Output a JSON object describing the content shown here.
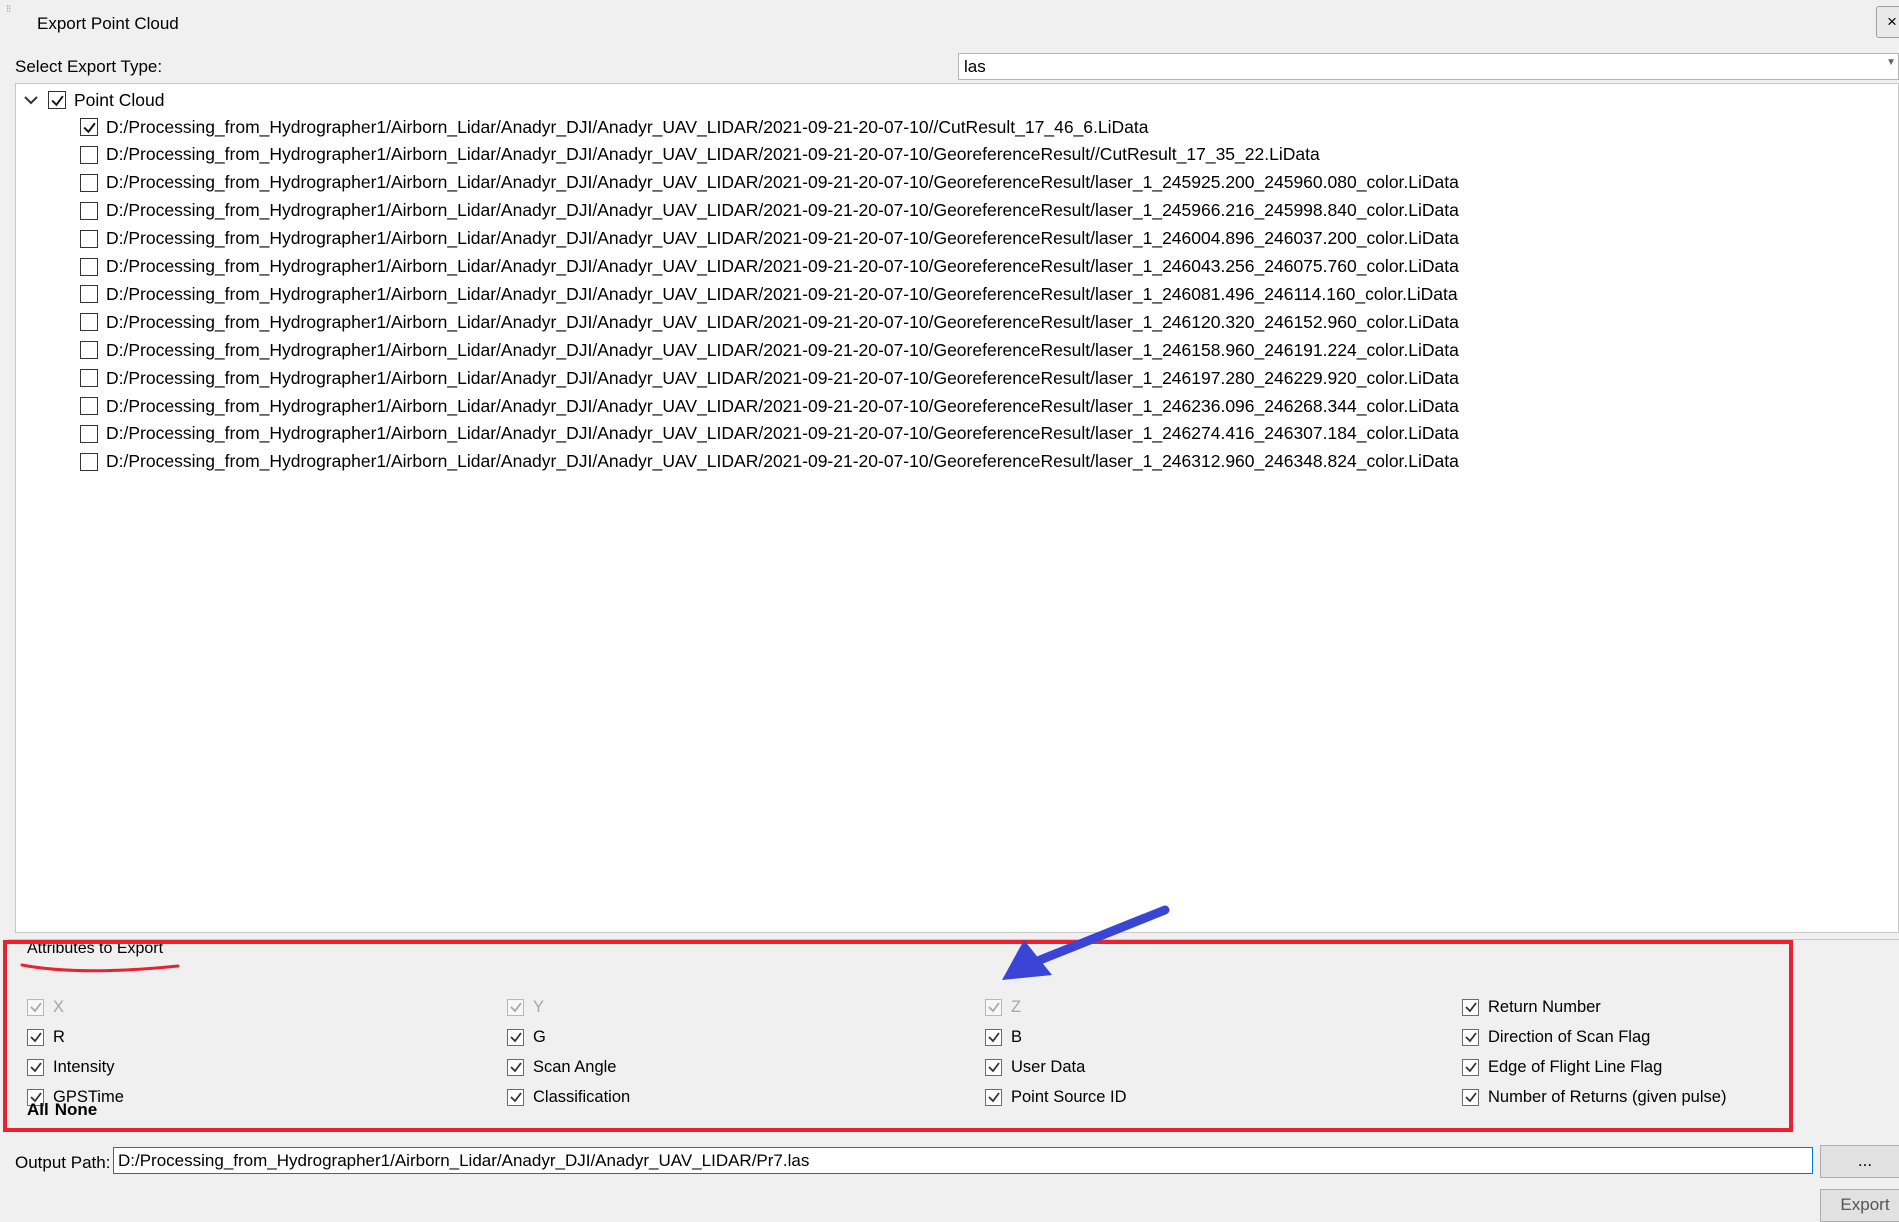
{
  "window": {
    "title": "Export Point Cloud",
    "close_label": "×"
  },
  "export_type": {
    "label": "Select Export Type:",
    "value": "las"
  },
  "tree": {
    "root": {
      "label": "Point Cloud",
      "checked": true,
      "expanded": true
    },
    "items": [
      {
        "label": "D:/Processing_from_Hydrographer1/Airborn_Lidar/Anadyr_DJI/Anadyr_UAV_LIDAR/2021-09-21-20-07-10//CutResult_17_46_6.LiData",
        "checked": true
      },
      {
        "label": "D:/Processing_from_Hydrographer1/Airborn_Lidar/Anadyr_DJI/Anadyr_UAV_LIDAR/2021-09-21-20-07-10/GeoreferenceResult//CutResult_17_35_22.LiData",
        "checked": false
      },
      {
        "label": "D:/Processing_from_Hydrographer1/Airborn_Lidar/Anadyr_DJI/Anadyr_UAV_LIDAR/2021-09-21-20-07-10/GeoreferenceResult/laser_1_245925.200_245960.080_color.LiData",
        "checked": false
      },
      {
        "label": "D:/Processing_from_Hydrographer1/Airborn_Lidar/Anadyr_DJI/Anadyr_UAV_LIDAR/2021-09-21-20-07-10/GeoreferenceResult/laser_1_245966.216_245998.840_color.LiData",
        "checked": false
      },
      {
        "label": "D:/Processing_from_Hydrographer1/Airborn_Lidar/Anadyr_DJI/Anadyr_UAV_LIDAR/2021-09-21-20-07-10/GeoreferenceResult/laser_1_246004.896_246037.200_color.LiData",
        "checked": false
      },
      {
        "label": "D:/Processing_from_Hydrographer1/Airborn_Lidar/Anadyr_DJI/Anadyr_UAV_LIDAR/2021-09-21-20-07-10/GeoreferenceResult/laser_1_246043.256_246075.760_color.LiData",
        "checked": false
      },
      {
        "label": "D:/Processing_from_Hydrographer1/Airborn_Lidar/Anadyr_DJI/Anadyr_UAV_LIDAR/2021-09-21-20-07-10/GeoreferenceResult/laser_1_246081.496_246114.160_color.LiData",
        "checked": false
      },
      {
        "label": "D:/Processing_from_Hydrographer1/Airborn_Lidar/Anadyr_DJI/Anadyr_UAV_LIDAR/2021-09-21-20-07-10/GeoreferenceResult/laser_1_246120.320_246152.960_color.LiData",
        "checked": false
      },
      {
        "label": "D:/Processing_from_Hydrographer1/Airborn_Lidar/Anadyr_DJI/Anadyr_UAV_LIDAR/2021-09-21-20-07-10/GeoreferenceResult/laser_1_246158.960_246191.224_color.LiData",
        "checked": false
      },
      {
        "label": "D:/Processing_from_Hydrographer1/Airborn_Lidar/Anadyr_DJI/Anadyr_UAV_LIDAR/2021-09-21-20-07-10/GeoreferenceResult/laser_1_246197.280_246229.920_color.LiData",
        "checked": false
      },
      {
        "label": "D:/Processing_from_Hydrographer1/Airborn_Lidar/Anadyr_DJI/Anadyr_UAV_LIDAR/2021-09-21-20-07-10/GeoreferenceResult/laser_1_246236.096_246268.344_color.LiData",
        "checked": false
      },
      {
        "label": "D:/Processing_from_Hydrographer1/Airborn_Lidar/Anadyr_DJI/Anadyr_UAV_LIDAR/2021-09-21-20-07-10/GeoreferenceResult/laser_1_246274.416_246307.184_color.LiData",
        "checked": false
      },
      {
        "label": "D:/Processing_from_Hydrographer1/Airborn_Lidar/Anadyr_DJI/Anadyr_UAV_LIDAR/2021-09-21-20-07-10/GeoreferenceResult/laser_1_246312.960_246348.824_color.LiData",
        "checked": false
      }
    ]
  },
  "attributes": {
    "legend": "Attributes to Export",
    "columns": [
      [
        {
          "label": "X",
          "checked": true,
          "disabled": true
        },
        {
          "label": "R",
          "checked": true,
          "disabled": false
        },
        {
          "label": "Intensity",
          "checked": true,
          "disabled": false
        },
        {
          "label": "GPSTime",
          "checked": true,
          "disabled": false
        }
      ],
      [
        {
          "label": "Y",
          "checked": true,
          "disabled": true
        },
        {
          "label": "G",
          "checked": true,
          "disabled": false
        },
        {
          "label": "Scan Angle",
          "checked": true,
          "disabled": false
        },
        {
          "label": "Classification",
          "checked": true,
          "disabled": false
        }
      ],
      [
        {
          "label": "Z",
          "checked": true,
          "disabled": true
        },
        {
          "label": "B",
          "checked": true,
          "disabled": false
        },
        {
          "label": "User Data",
          "checked": true,
          "disabled": false
        },
        {
          "label": "Point Source ID",
          "checked": true,
          "disabled": false
        }
      ],
      [
        {
          "label": "Return Number",
          "checked": true,
          "disabled": false
        },
        {
          "label": "Direction of Scan Flag",
          "checked": true,
          "disabled": false
        },
        {
          "label": "Edge of Flight Line Flag",
          "checked": true,
          "disabled": false
        },
        {
          "label": "Number of Returns (given pulse)",
          "checked": true,
          "disabled": false
        }
      ]
    ],
    "all_label": "All",
    "none_label": "None"
  },
  "output": {
    "label": "Output Path:",
    "value": "D:/Processing_from_Hydrographer1/Airborn_Lidar/Anadyr_DJI/Anadyr_UAV_LIDAR/Pr7.las",
    "browse_label": "...",
    "export_label": "Export"
  },
  "colors": {
    "annotation_box": "#e8232f",
    "annotation_arrow": "#3a45d6",
    "input_focus": "#0078d7"
  },
  "icons": {
    "expander": "chevron-down-icon",
    "check": "checkmark-icon",
    "dropdown": "dropdown-arrow-icon"
  }
}
